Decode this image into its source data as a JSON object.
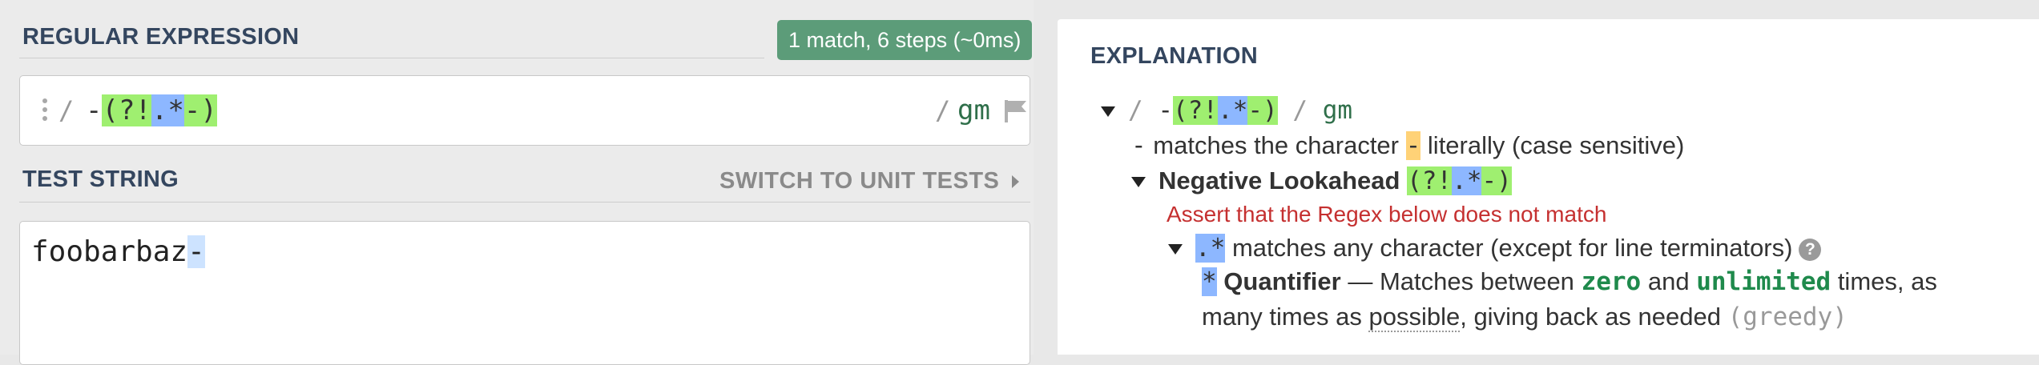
{
  "regex_panel": {
    "title": "REGULAR EXPRESSION",
    "match_info": "1 match, 6 steps (~0ms)",
    "delimiter_open": "/",
    "regex_parts": [
      "-",
      "(?!",
      ".*",
      "-)"
    ],
    "delimiter_close": "/",
    "flags": "gm",
    "icons": {
      "handle": "drag-handle-icon",
      "flag": "flag-icon"
    }
  },
  "test_panel": {
    "title": "TEST STRING",
    "switch_label": "SWITCH TO UNIT TESTS",
    "text_before": "foobarbaz",
    "text_match": "-"
  },
  "explanation": {
    "title": "EXPLANATION",
    "root": {
      "open": "/",
      "parts": [
        "-",
        "(?!",
        ".",
        "*",
        "-)"
      ],
      "close": "/",
      "flags": "gm"
    },
    "line1": {
      "dash": "-",
      "pre": "matches the character",
      "char": "-",
      "post": "literally (case sensitive)"
    },
    "lookahead": {
      "label": "Negative Lookahead",
      "parts": [
        "(?!",
        ".*",
        "-)"
      ]
    },
    "assert": "Assert that the Regex below does not match",
    "dotstar": {
      "token": ".*",
      "desc": "matches any character (except for line terminators)",
      "help": "?"
    },
    "quant": {
      "token": "*",
      "label": "Quantifier",
      "dash": "—",
      "pre": "Matches between",
      "zero": "zero",
      "and": "and",
      "unlimited": "unlimited",
      "post": "times, as",
      "line2_pre": "many times as",
      "possible": "possible",
      "line2_post": ", giving back as needed",
      "greedy": "(greedy)"
    }
  }
}
